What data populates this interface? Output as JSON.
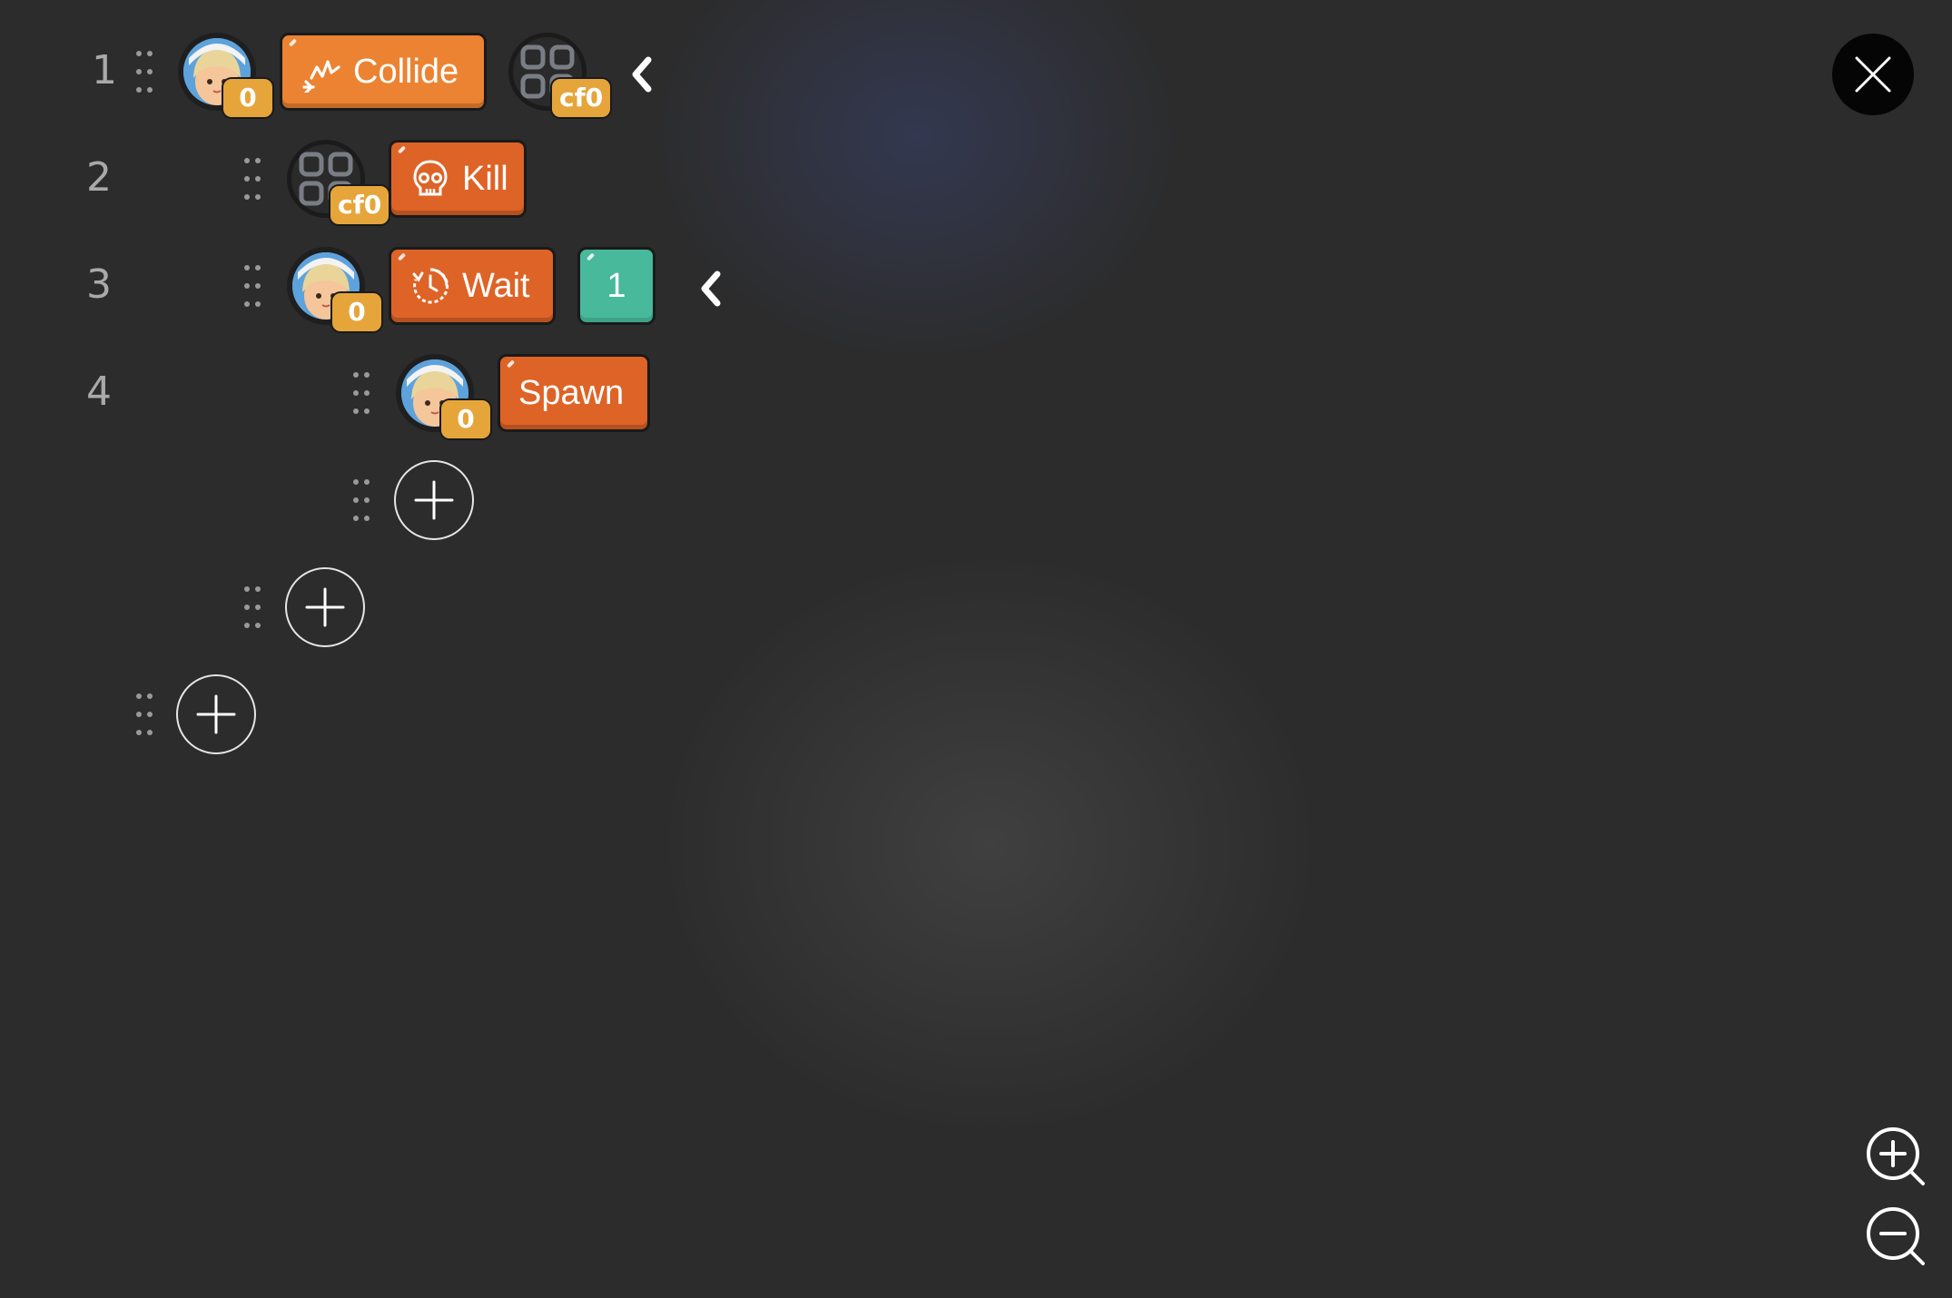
{
  "toolbar": {
    "close_icon": "close-icon",
    "zoom_in_icon": "zoom-in-icon",
    "zoom_out_icon": "zoom-out-icon"
  },
  "colors": {
    "background": "#2d2d2d",
    "action_block": "#de6327",
    "trigger_block": "#ec8332",
    "value_block": "#48b99b",
    "badge": "#e6a53b"
  },
  "lines": [
    {
      "number": "1",
      "subject": {
        "type": "character",
        "badge": "0"
      },
      "block": {
        "label": "Collide",
        "icon": "collision-icon"
      },
      "target": {
        "type": "cf",
        "badge": "cf0"
      },
      "collapse_icon": "chevron-left-icon"
    },
    {
      "number": "2",
      "subject": {
        "type": "cf",
        "badge": "cf0"
      },
      "block": {
        "label": "Kill",
        "icon": "skull-icon"
      }
    },
    {
      "number": "3",
      "subject": {
        "type": "character",
        "badge": "0"
      },
      "block": {
        "label": "Wait",
        "icon": "timer-icon"
      },
      "value": "1",
      "collapse_icon": "chevron-left-icon"
    },
    {
      "number": "4",
      "subject": {
        "type": "character",
        "badge": "0"
      },
      "block": {
        "label": "Spawn"
      }
    }
  ],
  "add_buttons": [
    {
      "indent_level": 3,
      "icon": "plus-icon"
    },
    {
      "indent_level": 2,
      "icon": "plus-icon"
    },
    {
      "indent_level": 1,
      "icon": "plus-icon"
    }
  ]
}
